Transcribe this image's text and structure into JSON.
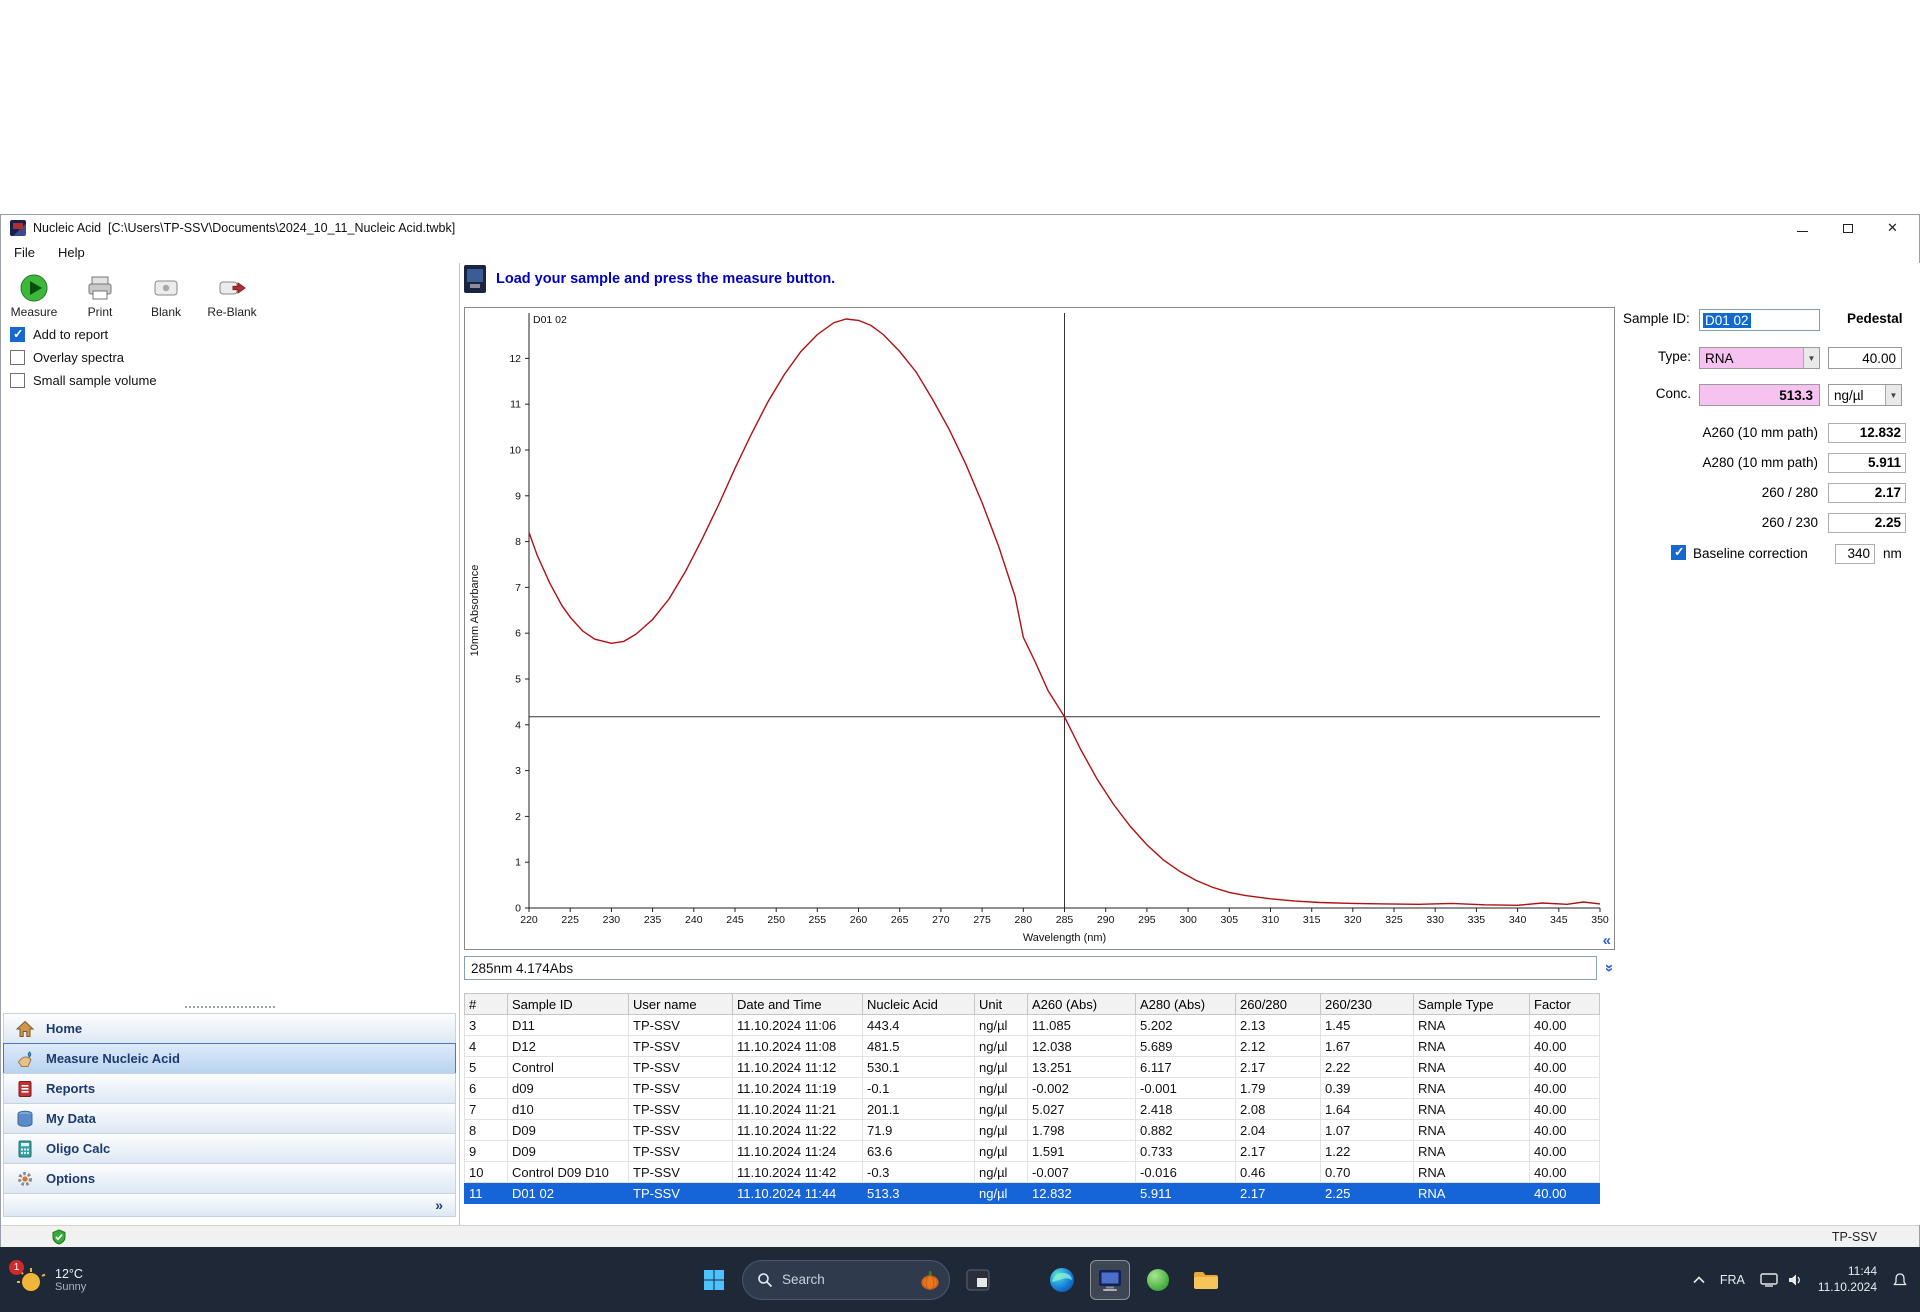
{
  "window": {
    "title": "Nucleic Acid  [C:\\Users\\TP-SSV\\Documents\\2024_10_11_Nucleic Acid.twbk]"
  },
  "icons": {
    "close": "✕",
    "chevrons_collapse": "«",
    "chevrons_expand": "»",
    "nav_expander": "»",
    "combo_arrow": "▼"
  },
  "menu": {
    "items": [
      {
        "label": "File"
      },
      {
        "label": "Help"
      }
    ]
  },
  "toolbar": {
    "buttons": [
      {
        "label": "Measure"
      },
      {
        "label": "Print"
      },
      {
        "label": "Blank"
      },
      {
        "label": "Re-Blank"
      }
    ]
  },
  "options": {
    "checkboxes": [
      {
        "label": "Add to report",
        "checked": true
      },
      {
        "label": "Overlay spectra",
        "checked": false
      },
      {
        "label": "Small sample volume",
        "checked": false
      }
    ]
  },
  "nav": {
    "items": [
      {
        "label": "Home",
        "selected": false
      },
      {
        "label": "Measure Nucleic Acid",
        "selected": true
      },
      {
        "label": "Reports",
        "selected": false
      },
      {
        "label": "My Data",
        "selected": false
      },
      {
        "label": "Oligo Calc",
        "selected": false
      },
      {
        "label": "Options",
        "selected": false
      }
    ]
  },
  "main": {
    "instruction": "Load your sample and press the measure button.",
    "readout": "285nm 4.174Abs"
  },
  "chart_data": {
    "type": "line",
    "series_label": "D01 02",
    "xlabel": "Wavelength (nm)",
    "ylabel": "10mm Absorbance",
    "xlim": [
      220,
      350
    ],
    "ylim": [
      0,
      13
    ],
    "x_tick_step": 5,
    "y_ticks": [
      0,
      1,
      2,
      3,
      4,
      5,
      6,
      7,
      8,
      9,
      10,
      11,
      12
    ],
    "crosshair": {
      "x": 285,
      "y": 4.174
    },
    "line_color": "#b01010",
    "points": [
      [
        220,
        8.2
      ],
      [
        221,
        7.7
      ],
      [
        222.5,
        7.1
      ],
      [
        224,
        6.6
      ],
      [
        225,
        6.35
      ],
      [
        226.5,
        6.05
      ],
      [
        228,
        5.87
      ],
      [
        230,
        5.78
      ],
      [
        231.5,
        5.82
      ],
      [
        233,
        5.98
      ],
      [
        235,
        6.3
      ],
      [
        237,
        6.75
      ],
      [
        239,
        7.35
      ],
      [
        241,
        8.05
      ],
      [
        243,
        8.8
      ],
      [
        245,
        9.6
      ],
      [
        247,
        10.35
      ],
      [
        249,
        11.05
      ],
      [
        251,
        11.65
      ],
      [
        253,
        12.15
      ],
      [
        255,
        12.52
      ],
      [
        257,
        12.78
      ],
      [
        258.5,
        12.86
      ],
      [
        260,
        12.83
      ],
      [
        261.5,
        12.72
      ],
      [
        263,
        12.52
      ],
      [
        265,
        12.15
      ],
      [
        267,
        11.7
      ],
      [
        269,
        11.1
      ],
      [
        271,
        10.45
      ],
      [
        273,
        9.7
      ],
      [
        275,
        8.85
      ],
      [
        277,
        7.9
      ],
      [
        279,
        6.8
      ],
      [
        280,
        5.911
      ],
      [
        281.5,
        5.35
      ],
      [
        283,
        4.75
      ],
      [
        285,
        4.174
      ],
      [
        287,
        3.45
      ],
      [
        289,
        2.8
      ],
      [
        291,
        2.25
      ],
      [
        293,
        1.78
      ],
      [
        295,
        1.38
      ],
      [
        297,
        1.05
      ],
      [
        299,
        0.8
      ],
      [
        301,
        0.6
      ],
      [
        303,
        0.45
      ],
      [
        305,
        0.34
      ],
      [
        307,
        0.27
      ],
      [
        310,
        0.2
      ],
      [
        313,
        0.15
      ],
      [
        316,
        0.12
      ],
      [
        320,
        0.1
      ],
      [
        324,
        0.09
      ],
      [
        328,
        0.08
      ],
      [
        332,
        0.1
      ],
      [
        336,
        0.07
      ],
      [
        340,
        0.06
      ],
      [
        343,
        0.11
      ],
      [
        346,
        0.08
      ],
      [
        348,
        0.13
      ],
      [
        350,
        0.09
      ]
    ]
  },
  "results_panel": {
    "sample_id_label": "Sample ID:",
    "sample_id_value": "D01 02",
    "mode_label": "Pedestal",
    "type_label": "Type:",
    "type_value": "RNA",
    "factor_value": "40.00",
    "conc_label": "Conc.",
    "conc_value": "513.3",
    "conc_unit": "ng/µl",
    "metrics": [
      {
        "label": "A260 (10 mm path)",
        "value": "12.832"
      },
      {
        "label": "A280 (10 mm path)",
        "value": "5.911"
      },
      {
        "label": "260 / 280",
        "value": "2.17"
      },
      {
        "label": "260 / 230",
        "value": "2.25"
      }
    ],
    "baseline": {
      "label": "Baseline correction",
      "checked": true,
      "value": "340",
      "unit": "nm"
    }
  },
  "table": {
    "headers": [
      "#",
      "Sample ID",
      "User name",
      "Date and Time",
      "Nucleic Acid",
      "Unit",
      "A260 (Abs)",
      "A280 (Abs)",
      "260/280",
      "260/230",
      "Sample Type",
      "Factor"
    ],
    "rows": [
      [
        "3",
        "D11",
        "TP-SSV",
        "11.10.2024 11:06",
        "443.4",
        "ng/µl",
        "11.085",
        "5.202",
        "2.13",
        "1.45",
        "RNA",
        "40.00"
      ],
      [
        "4",
        "D12",
        "TP-SSV",
        "11.10.2024 11:08",
        "481.5",
        "ng/µl",
        "12.038",
        "5.689",
        "2.12",
        "1.67",
        "RNA",
        "40.00"
      ],
      [
        "5",
        "Control",
        "TP-SSV",
        "11.10.2024 11:12",
        "530.1",
        "ng/µl",
        "13.251",
        "6.117",
        "2.17",
        "2.22",
        "RNA",
        "40.00"
      ],
      [
        "6",
        "d09",
        "TP-SSV",
        "11.10.2024 11:19",
        "-0.1",
        "ng/µl",
        "-0.002",
        "-0.001",
        "1.79",
        "0.39",
        "RNA",
        "40.00"
      ],
      [
        "7",
        "d10",
        "TP-SSV",
        "11.10.2024 11:21",
        "201.1",
        "ng/µl",
        "5.027",
        "2.418",
        "2.08",
        "1.64",
        "RNA",
        "40.00"
      ],
      [
        "8",
        "D09",
        "TP-SSV",
        "11.10.2024 11:22",
        "71.9",
        "ng/µl",
        "1.798",
        "0.882",
        "2.04",
        "1.07",
        "RNA",
        "40.00"
      ],
      [
        "9",
        "D09",
        "TP-SSV",
        "11.10.2024 11:24",
        "63.6",
        "ng/µl",
        "1.591",
        "0.733",
        "2.17",
        "1.22",
        "RNA",
        "40.00"
      ],
      [
        "10",
        "Control D09 D10",
        "TP-SSV",
        "11.10.2024 11:42",
        "-0.3",
        "ng/µl",
        "-0.007",
        "-0.016",
        "0.46",
        "0.70",
        "RNA",
        "40.00"
      ],
      [
        "11",
        "D01 02",
        "TP-SSV",
        "11.10.2024 11:44",
        "513.3",
        "ng/µl",
        "12.832",
        "5.911",
        "2.17",
        "2.25",
        "RNA",
        "40.00"
      ]
    ],
    "selected_index": 8
  },
  "statusbar": {
    "user": "TP-SSV"
  },
  "taskbar": {
    "weather": {
      "badge": "1",
      "temp": "12°C",
      "condition": "Sunny"
    },
    "search": {
      "placeholder": "Search"
    },
    "tray": {
      "language": "FRA",
      "time": "11:44",
      "date": "11.10.2024"
    }
  },
  "colors": {
    "selection_blue": "#1565d8",
    "instruction_blue": "#0000c0",
    "curve_red": "#b01010",
    "field_pink": "#f6c2f0"
  }
}
